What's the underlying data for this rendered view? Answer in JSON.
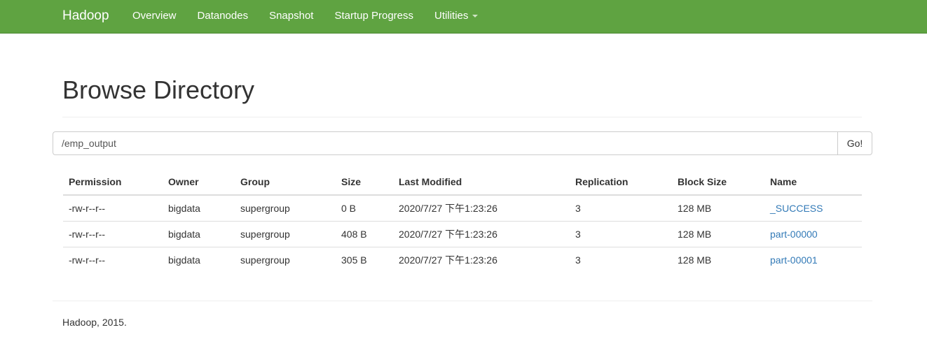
{
  "navbar": {
    "brand": "Hadoop",
    "links": [
      {
        "label": "Overview"
      },
      {
        "label": "Datanodes"
      },
      {
        "label": "Snapshot"
      },
      {
        "label": "Startup Progress"
      },
      {
        "label": "Utilities"
      }
    ],
    "color": "#5fa341"
  },
  "page": {
    "title": "Browse Directory"
  },
  "path": {
    "value": "/emp_output",
    "go_label": "Go!"
  },
  "table": {
    "headers": [
      "Permission",
      "Owner",
      "Group",
      "Size",
      "Last Modified",
      "Replication",
      "Block Size",
      "Name"
    ],
    "rows": [
      [
        "-rw-r--r--",
        "bigdata",
        "supergroup",
        "0 B",
        "2020/7/27 下午1:23:26",
        "3",
        "128 MB",
        "_SUCCESS"
      ],
      [
        "-rw-r--r--",
        "bigdata",
        "supergroup",
        "408 B",
        "2020/7/27 下午1:23:26",
        "3",
        "128 MB",
        "part-00000"
      ],
      [
        "-rw-r--r--",
        "bigdata",
        "supergroup",
        "305 B",
        "2020/7/27 下午1:23:26",
        "3",
        "128 MB",
        "part-00001"
      ]
    ],
    "link_color": "#337ab7"
  },
  "footer": {
    "text": "Hadoop, 2015."
  }
}
